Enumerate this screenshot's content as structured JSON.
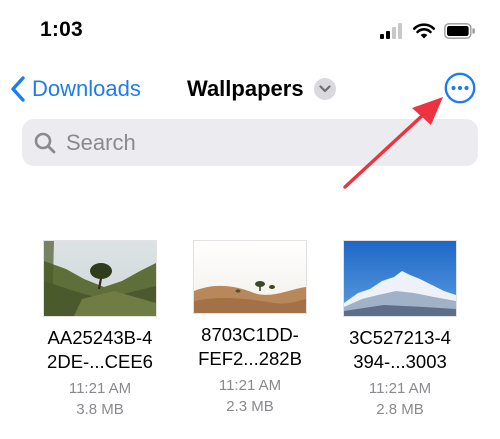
{
  "status_bar": {
    "time": "1:03",
    "icons": [
      "cellular-signal-icon",
      "wifi-icon",
      "battery-icon"
    ]
  },
  "nav": {
    "back_label": "Downloads",
    "title": "Wallpapers",
    "more_icon": "ellipsis-circle-icon",
    "accent_color": "#1d7cf2"
  },
  "search": {
    "placeholder": "Search",
    "value": ""
  },
  "files": [
    {
      "name_line1": "AA25243B-4",
      "name_line2": "2DE-...CEE6",
      "time": "11:21 AM",
      "size": "3.8 MB"
    },
    {
      "name_line1": "8703C1DD-",
      "name_line2": "FEF2...282B",
      "time": "11:21 AM",
      "size": "2.3 MB"
    },
    {
      "name_line1": "3C527213-4",
      "name_line2": "394-...3003",
      "time": "11:21 AM",
      "size": "2.8 MB"
    }
  ],
  "annotation": {
    "arrow_color": "#ee3340"
  }
}
